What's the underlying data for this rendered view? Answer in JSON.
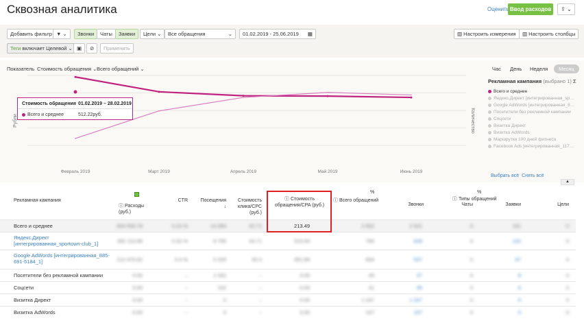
{
  "header": {
    "title": "Сквозная аналитика",
    "rate": "Оценить",
    "add_costs": "Ввод расходов",
    "export": "⇪ ⌄"
  },
  "filters": {
    "add_filter": "Добавить фильтр",
    "funnel": "▼ ⌄",
    "calls": "Звонки",
    "chats": "Чаты",
    "requests": "Заявки",
    "goals": "Цели ⌄",
    "all_requests": "Все обращения",
    "date_range": "01.02.2019 - 25.06.2019",
    "config_dims": "Настроить измерения",
    "config_cols": "Настроить столбцы",
    "tag_label": "Теги",
    "tag_op": "включает",
    "tag_val": "Целевой",
    "apply": "Применить"
  },
  "chart_controls": {
    "metric_label": "Показатель",
    "metric": "Стоимость обращения ⌄",
    "scope": "Всего обращений ⌄",
    "periods": [
      "Час",
      "День",
      "Неделя",
      "Месяц"
    ],
    "active_period": "Месяц"
  },
  "chart_data": {
    "type": "line",
    "x": [
      "Февраль 2019",
      "Март 2019",
      "Апрель 2019",
      "Май 2019",
      "Июнь 2019"
    ],
    "left_axis_label": "Рубли",
    "right_axis_label": "Количество",
    "series": [
      {
        "name": "Стоимость обращения",
        "values": [
          512.22,
          290,
          230,
          225,
          205
        ]
      },
      {
        "name": "Количество",
        "values": [
          70,
          345,
          480,
          530,
          505
        ]
      }
    ],
    "ylim_left": [
      0,
      1050
    ],
    "ylim_right": [
      0,
      700
    ]
  },
  "tooltip": {
    "title": "Стоимость обращения",
    "dates": "01.02.2019 – 28.02.2019",
    "label": "Всего и среднее",
    "value": "512.22руб."
  },
  "legend": {
    "title": "Рекламная кампания",
    "subtitle": "(выбрано 1)",
    "items": [
      "Всего и среднее",
      "Яндекс.Директ [интегрированная_sportown-club_1]",
      "Google AdWords [интегрированная_885-691-5184_1]",
      "Посетители без рекламной кампании",
      "Соцсети",
      "Визитка Директ",
      "Визитка AdWords",
      "Маршрутки 100 дней фитнеса",
      "Facebook Ads [интегрированная_117593]"
    ],
    "select_all": "Выбрать всё",
    "clear_all": "Снять всё"
  },
  "table": {
    "headers": {
      "campaign": "Рекламная кампания",
      "costs": "Расходы (руб.)",
      "ctr": "CTR",
      "visits": "Посещения",
      "cpc": "Стоимость клика/CPC (руб.)",
      "cpa": "Стоимость обращения/CPA (руб.)",
      "total": "Всего обращений",
      "types": "Типы обращений",
      "calls": "Звонки",
      "chats": "Чаты",
      "requests": "Заявки",
      "goals": "Цели"
    },
    "rows": [
      {
        "name": "Всего и среднее",
        "costs": "604 556.78",
        "ctr": "0.24 %",
        "visits": "14 084",
        "cpc": "42.71",
        "cpa": "213.49",
        "total": "2 832",
        "calls": "2 641",
        "chats": "0",
        "requests": "191",
        "goals": "0"
      },
      {
        "name": "Яндекс.Директ [интегрированная_sportown-club_1]",
        "costs": "392 114.86",
        "ctr": "0.32 %",
        "visits": "8 755",
        "cpc": "43.71",
        "cpa": "515.94",
        "total": "760",
        "calls": "628",
        "chats": "0",
        "requests": "132",
        "goals": "0"
      },
      {
        "name": "Google AdWords [интегрированная_885-691-5184_1]",
        "costs": "212 475.82",
        "ctr": "0.4 %",
        "visits": "5 329",
        "cpc": "40.3",
        "cpa": "351.89",
        "total": "604",
        "calls": "537",
        "chats": "0",
        "requests": "67",
        "goals": "0"
      },
      {
        "name": "Посетители без рекламной кампании",
        "costs": "0.00",
        "ctr": "–",
        "visits": "2 332",
        "cpc": "–",
        "cpa": "0.00",
        "total": "45",
        "calls": "37",
        "chats": "0",
        "requests": "8",
        "goals": "0"
      },
      {
        "name": "Соцсети",
        "costs": "0.00",
        "ctr": "–",
        "visits": "152",
        "cpc": "–",
        "cpa": "0.00",
        "total": "41",
        "calls": "35",
        "chats": "0",
        "requests": "6",
        "goals": "0"
      },
      {
        "name": "Визитка Директ",
        "costs": "0.00",
        "ctr": "–",
        "visits": "0",
        "cpc": "–",
        "cpa": "0.00",
        "total": "1 247",
        "calls": "1 247",
        "chats": "0",
        "requests": "0",
        "goals": "0"
      },
      {
        "name": "Визитка AdWords",
        "costs": "0.00",
        "ctr": "–",
        "visits": "0",
        "cpc": "–",
        "cpa": "0.00",
        "total": "107",
        "calls": "107",
        "chats": "0",
        "requests": "0",
        "goals": "0"
      }
    ]
  },
  "colors": {
    "accent": "#c0237f",
    "accent_light": "#d97cc0",
    "green": "#76c043",
    "link": "#3b7fc4"
  }
}
